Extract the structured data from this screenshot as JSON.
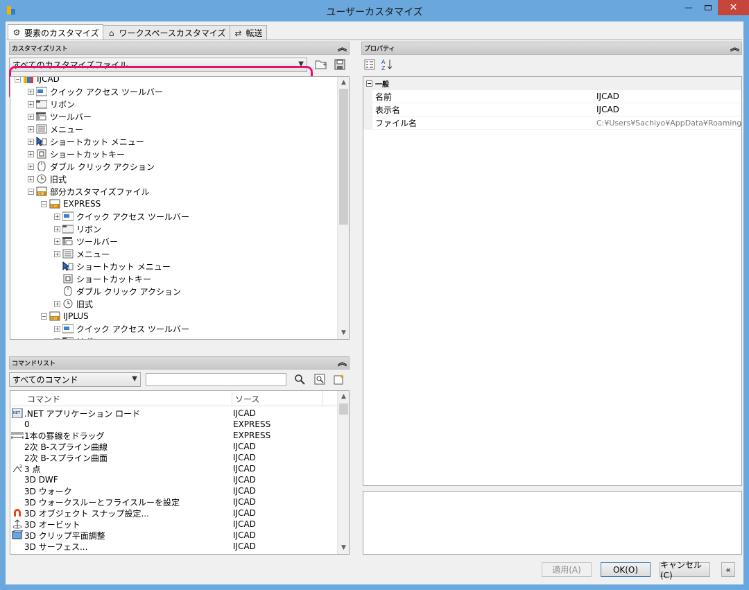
{
  "window": {
    "title": "ユーザーカスタマイズ"
  },
  "tabs": [
    {
      "label": "要素のカスタマイズ",
      "icon": "gear-icon"
    },
    {
      "label": "ワークスペースカスタマイズ",
      "icon": "home-icon"
    },
    {
      "label": "転送",
      "icon": "transfer-icon"
    }
  ],
  "customize_panel": {
    "title": "カスタマイズリスト",
    "file_filter": "すべてのカスタマイズファイル",
    "tree": [
      {
        "label": "IJCAD",
        "level": 0,
        "icon": "cad-icon"
      },
      {
        "label": "クイック アクセス ツールバー",
        "level": 1,
        "icon": "toolbar-icon"
      },
      {
        "label": "リボン",
        "level": 1,
        "icon": "ribbon-icon"
      },
      {
        "label": "ツールバー",
        "level": 1,
        "icon": "toolbar2-icon"
      },
      {
        "label": "メニュー",
        "level": 1,
        "icon": "menu-icon"
      },
      {
        "label": "ショートカット メニュー",
        "level": 1,
        "icon": "cursor-icon"
      },
      {
        "label": "ショートカットキー",
        "level": 1,
        "icon": "keyboard-icon"
      },
      {
        "label": "ダブル クリック アクション",
        "level": 1,
        "icon": "mouse-icon"
      },
      {
        "label": "旧式",
        "level": 1,
        "icon": "clock-icon"
      },
      {
        "label": "部分カスタマイズファイル",
        "level": 1,
        "icon": "cui-icon"
      },
      {
        "label": "EXPRESS",
        "level": 2,
        "icon": "cui-icon"
      },
      {
        "label": "クイック アクセス ツールバー",
        "level": 3,
        "icon": "toolbar-icon"
      },
      {
        "label": "リボン",
        "level": 3,
        "icon": "ribbon-icon"
      },
      {
        "label": "ツールバー",
        "level": 3,
        "icon": "toolbar2-icon"
      },
      {
        "label": "メニュー",
        "level": 3,
        "icon": "menu-icon"
      },
      {
        "label": "ショートカット メニュー",
        "level": 3,
        "icon": "cursor-icon"
      },
      {
        "label": "ショートカットキー",
        "level": 3,
        "icon": "keyboard-icon"
      },
      {
        "label": "ダブル クリック アクション",
        "level": 3,
        "icon": "mouse-icon"
      },
      {
        "label": "旧式",
        "level": 3,
        "icon": "clock-icon"
      },
      {
        "label": "IJPLUS",
        "level": 2,
        "icon": "cui-icon"
      },
      {
        "label": "クイック アクセス ツールバー",
        "level": 3,
        "icon": "toolbar-icon"
      },
      {
        "label": "リボン",
        "level": 3,
        "icon": "ribbon-icon"
      }
    ]
  },
  "command_panel": {
    "title": "コマンドリスト",
    "filter": "すべてのコマンド",
    "search_value": "",
    "columns": [
      "コマンド",
      "ソース"
    ],
    "rows": [
      {
        "name": ".NET アプリケーション ロード",
        "source": "IJCAD",
        "icon": "net-icon"
      },
      {
        "name": "0",
        "source": "EXPRESS",
        "icon": ""
      },
      {
        "name": "1本の罫線をドラッグ",
        "source": "EXPRESS",
        "icon": "line-icon"
      },
      {
        "name": "2次 B-スプライン曲線",
        "source": "IJCAD",
        "icon": ""
      },
      {
        "name": "2次 B-スプライン曲面",
        "source": "IJCAD",
        "icon": ""
      },
      {
        "name": "3 点",
        "source": "IJCAD",
        "icon": "ucs-icon"
      },
      {
        "name": "3D DWF",
        "source": "IJCAD",
        "icon": ""
      },
      {
        "name": "3D ウォーク",
        "source": "IJCAD",
        "icon": ""
      },
      {
        "name": "3D ウォークスルーとフライスルーを設定",
        "source": "IJCAD",
        "icon": ""
      },
      {
        "name": "3D オブジェクト スナップ設定...",
        "source": "IJCAD",
        "icon": "magnet-icon"
      },
      {
        "name": "3D オービット",
        "source": "IJCAD",
        "icon": "orbit-icon"
      },
      {
        "name": "3D クリップ平面調整",
        "source": "IJCAD",
        "icon": "clip-icon"
      },
      {
        "name": "3D サーフェス...",
        "source": "IJCAD",
        "icon": ""
      }
    ]
  },
  "properties_panel": {
    "title": "プロパティ",
    "category": "一般",
    "rows": [
      {
        "name": "名前",
        "value": "IJCAD"
      },
      {
        "name": "表示名",
        "value": "IJCAD"
      },
      {
        "name": "ファイル名",
        "value": "C:¥Users¥Sachiyo¥AppData¥Roaming¥Int"
      }
    ]
  },
  "buttons": {
    "apply": "適用(A)",
    "ok": "OK(O)",
    "cancel": "キャンセル(C)"
  }
}
